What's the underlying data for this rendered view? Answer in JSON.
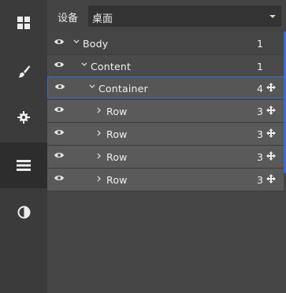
{
  "sidebar": {
    "items": [
      {
        "icon": "blocks-icon",
        "active": false
      },
      {
        "icon": "brush-icon",
        "active": false
      },
      {
        "icon": "gear-icon",
        "active": false
      },
      {
        "icon": "layers-icon",
        "active": true
      },
      {
        "icon": "contrast-icon",
        "active": false
      }
    ]
  },
  "header": {
    "device_label": "设备",
    "device_value": "桌面"
  },
  "layers": [
    {
      "name": "Body",
      "count": "1",
      "expanded": true
    },
    {
      "name": "Content",
      "count": "1",
      "expanded": true
    },
    {
      "name": "Container",
      "count": "4",
      "expanded": true,
      "selected": true
    },
    {
      "name": "Row",
      "count": "3",
      "expanded": false
    },
    {
      "name": "Row",
      "count": "3",
      "expanded": false
    },
    {
      "name": "Row",
      "count": "3",
      "expanded": false
    },
    {
      "name": "Row",
      "count": "3",
      "expanded": false
    }
  ],
  "colors": {
    "accent": "#2f6fd6"
  }
}
